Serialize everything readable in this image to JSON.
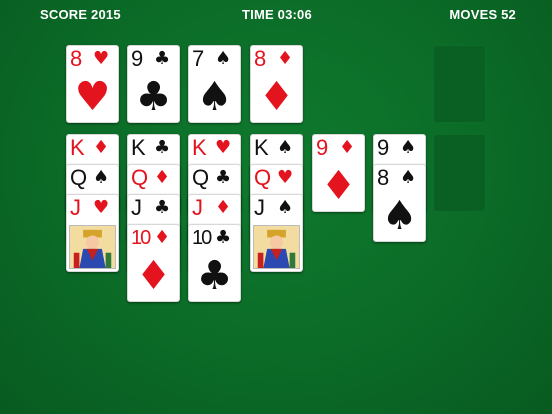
{
  "hud": {
    "score": "SCORE 2015",
    "time": "TIME 03:06",
    "moves": "MOVES 52"
  },
  "top_row": [
    {
      "rank": "8",
      "suit": "♥",
      "color": "red"
    },
    {
      "rank": "9",
      "suit": "♣",
      "color": "black"
    },
    {
      "rank": "7",
      "suit": "♠",
      "color": "black"
    },
    {
      "rank": "8",
      "suit": "♦",
      "color": "red"
    }
  ],
  "columns": [
    [
      {
        "rank": "K",
        "suit": "♦",
        "color": "red"
      },
      {
        "rank": "Q",
        "suit": "♠",
        "color": "black"
      },
      {
        "rank": "J",
        "suit": "♥",
        "color": "red",
        "face": true
      }
    ],
    [
      {
        "rank": "K",
        "suit": "♣",
        "color": "black"
      },
      {
        "rank": "Q",
        "suit": "♦",
        "color": "red"
      },
      {
        "rank": "J",
        "suit": "♣",
        "color": "black"
      },
      {
        "rank": "10",
        "suit": "♦",
        "color": "red"
      }
    ],
    [
      {
        "rank": "K",
        "suit": "♥",
        "color": "red"
      },
      {
        "rank": "Q",
        "suit": "♣",
        "color": "black"
      },
      {
        "rank": "J",
        "suit": "♦",
        "color": "red"
      },
      {
        "rank": "10",
        "suit": "♣",
        "color": "black"
      }
    ],
    [
      {
        "rank": "K",
        "suit": "♠",
        "color": "black"
      },
      {
        "rank": "Q",
        "suit": "♥",
        "color": "red"
      },
      {
        "rank": "J",
        "suit": "♠",
        "color": "black",
        "face": true
      }
    ],
    [
      {
        "rank": "9",
        "suit": "♦",
        "color": "red"
      }
    ],
    [
      {
        "rank": "9",
        "suit": "♠",
        "color": "black"
      },
      {
        "rank": "8",
        "suit": "♠",
        "color": "black"
      }
    ]
  ],
  "colors": {
    "felt": "#0b6b27",
    "red_suit": "#e3141e",
    "black_suit": "#111111"
  }
}
